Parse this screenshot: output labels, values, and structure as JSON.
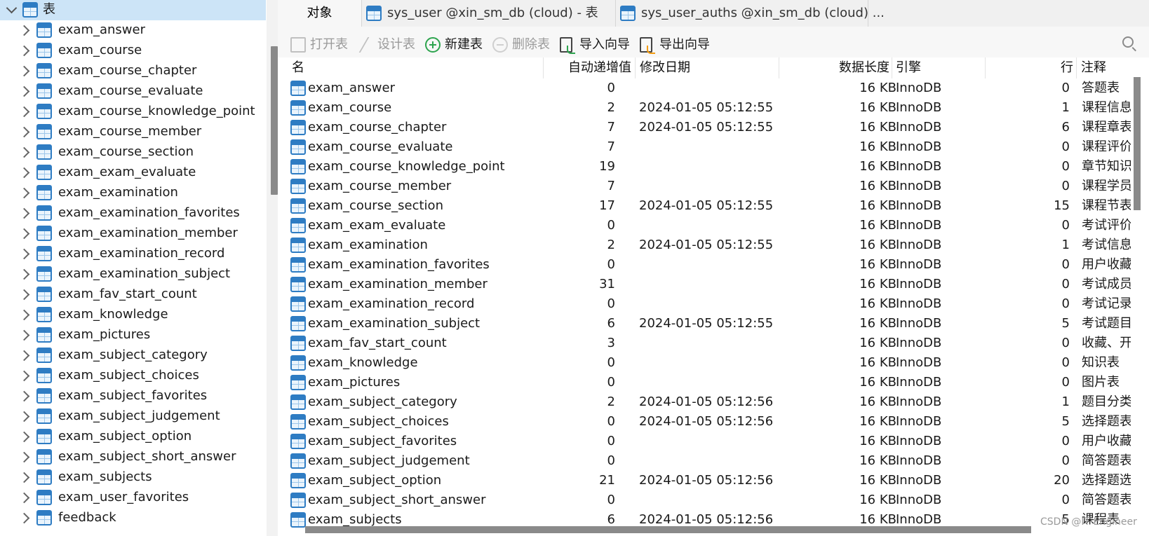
{
  "sidebar": {
    "root_label": "表",
    "items": [
      "exam_answer",
      "exam_course",
      "exam_course_chapter",
      "exam_course_evaluate",
      "exam_course_knowledge_point",
      "exam_course_member",
      "exam_course_section",
      "exam_exam_evaluate",
      "exam_examination",
      "exam_examination_favorites",
      "exam_examination_member",
      "exam_examination_record",
      "exam_examination_subject",
      "exam_fav_start_count",
      "exam_knowledge",
      "exam_pictures",
      "exam_subject_category",
      "exam_subject_choices",
      "exam_subject_favorites",
      "exam_subject_judgement",
      "exam_subject_option",
      "exam_subject_short_answer",
      "exam_subjects",
      "exam_user_favorites",
      "feedback"
    ]
  },
  "tabs": {
    "objects": "对象",
    "sys_user": "sys_user @xin_sm_db (cloud) - 表",
    "sys_user_auths": "sys_user_auths @xin_sm_db (cloud) ..."
  },
  "toolbar": {
    "open": "打开表",
    "design": "设计表",
    "new": "新建表",
    "delete": "删除表",
    "import": "导入向导",
    "export": "导出向导"
  },
  "grid": {
    "headers": {
      "name": "名",
      "auto_inc": "自动递增值",
      "modified": "修改日期",
      "data_length": "数据长度",
      "engine": "引擎",
      "rows": "行",
      "comment": "注释"
    },
    "rows": [
      {
        "name": "exam_answer",
        "auto_inc": "0",
        "modified": "",
        "data_length": "16 KB",
        "engine": "InnoDB",
        "rows": "0",
        "comment": "答题表"
      },
      {
        "name": "exam_course",
        "auto_inc": "2",
        "modified": "2024-01-05 05:12:55",
        "data_length": "16 KB",
        "engine": "InnoDB",
        "rows": "1",
        "comment": "课程信息"
      },
      {
        "name": "exam_course_chapter",
        "auto_inc": "7",
        "modified": "2024-01-05 05:12:55",
        "data_length": "16 KB",
        "engine": "InnoDB",
        "rows": "6",
        "comment": "课程章表"
      },
      {
        "name": "exam_course_evaluate",
        "auto_inc": "7",
        "modified": "",
        "data_length": "16 KB",
        "engine": "InnoDB",
        "rows": "0",
        "comment": "课程评价"
      },
      {
        "name": "exam_course_knowledge_point",
        "auto_inc": "19",
        "modified": "",
        "data_length": "16 KB",
        "engine": "InnoDB",
        "rows": "0",
        "comment": "章节知识"
      },
      {
        "name": "exam_course_member",
        "auto_inc": "7",
        "modified": "",
        "data_length": "16 KB",
        "engine": "InnoDB",
        "rows": "0",
        "comment": "课程学员"
      },
      {
        "name": "exam_course_section",
        "auto_inc": "17",
        "modified": "2024-01-05 05:12:55",
        "data_length": "16 KB",
        "engine": "InnoDB",
        "rows": "15",
        "comment": "课程节表"
      },
      {
        "name": "exam_exam_evaluate",
        "auto_inc": "0",
        "modified": "",
        "data_length": "16 KB",
        "engine": "InnoDB",
        "rows": "0",
        "comment": "考试评价"
      },
      {
        "name": "exam_examination",
        "auto_inc": "2",
        "modified": "2024-01-05 05:12:55",
        "data_length": "16 KB",
        "engine": "InnoDB",
        "rows": "1",
        "comment": "考试信息"
      },
      {
        "name": "exam_examination_favorites",
        "auto_inc": "0",
        "modified": "",
        "data_length": "16 KB",
        "engine": "InnoDB",
        "rows": "0",
        "comment": "用户收藏"
      },
      {
        "name": "exam_examination_member",
        "auto_inc": "31",
        "modified": "",
        "data_length": "16 KB",
        "engine": "InnoDB",
        "rows": "0",
        "comment": "考试成员"
      },
      {
        "name": "exam_examination_record",
        "auto_inc": "0",
        "modified": "",
        "data_length": "16 KB",
        "engine": "InnoDB",
        "rows": "0",
        "comment": "考试记录"
      },
      {
        "name": "exam_examination_subject",
        "auto_inc": "6",
        "modified": "2024-01-05 05:12:55",
        "data_length": "16 KB",
        "engine": "InnoDB",
        "rows": "5",
        "comment": "考试题目"
      },
      {
        "name": "exam_fav_start_count",
        "auto_inc": "3",
        "modified": "",
        "data_length": "16 KB",
        "engine": "InnoDB",
        "rows": "0",
        "comment": "收藏、开"
      },
      {
        "name": "exam_knowledge",
        "auto_inc": "0",
        "modified": "",
        "data_length": "16 KB",
        "engine": "InnoDB",
        "rows": "0",
        "comment": "知识表"
      },
      {
        "name": "exam_pictures",
        "auto_inc": "0",
        "modified": "",
        "data_length": "16 KB",
        "engine": "InnoDB",
        "rows": "0",
        "comment": "图片表"
      },
      {
        "name": "exam_subject_category",
        "auto_inc": "2",
        "modified": "2024-01-05 05:12:56",
        "data_length": "16 KB",
        "engine": "InnoDB",
        "rows": "1",
        "comment": "题目分类"
      },
      {
        "name": "exam_subject_choices",
        "auto_inc": "0",
        "modified": "2024-01-05 05:12:56",
        "data_length": "16 KB",
        "engine": "InnoDB",
        "rows": "5",
        "comment": "选择题表"
      },
      {
        "name": "exam_subject_favorites",
        "auto_inc": "0",
        "modified": "",
        "data_length": "16 KB",
        "engine": "InnoDB",
        "rows": "0",
        "comment": "用户收藏"
      },
      {
        "name": "exam_subject_judgement",
        "auto_inc": "0",
        "modified": "",
        "data_length": "16 KB",
        "engine": "InnoDB",
        "rows": "0",
        "comment": "简答题表"
      },
      {
        "name": "exam_subject_option",
        "auto_inc": "21",
        "modified": "2024-01-05 05:12:56",
        "data_length": "16 KB",
        "engine": "InnoDB",
        "rows": "20",
        "comment": "选择题选"
      },
      {
        "name": "exam_subject_short_answer",
        "auto_inc": "0",
        "modified": "",
        "data_length": "16 KB",
        "engine": "InnoDB",
        "rows": "0",
        "comment": "简答题表"
      },
      {
        "name": "exam_subjects",
        "auto_inc": "6",
        "modified": "2024-01-05 05:12:56",
        "data_length": "16 KB",
        "engine": "InnoDB",
        "rows": "5",
        "comment": "课程表"
      }
    ]
  },
  "watermark": "CSDN @IT·Engineer",
  "colors": {
    "selection": "#cce4f7",
    "table_icon": "#2e7cc3",
    "new_icon": "#2da44e",
    "export_icon": "#f39c12"
  }
}
